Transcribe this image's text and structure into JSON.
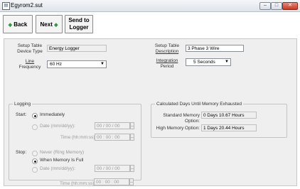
{
  "window": {
    "title": "Egyrom2.sut"
  },
  "toolbar": {
    "back_label": "Back",
    "next_label": "Next",
    "send_label_line1": "Send to",
    "send_label_line2": "Logger"
  },
  "setup": {
    "device_type_label_1": "Setup Table",
    "device_type_label_2": "Device Type",
    "device_type_value": "Energy Logger",
    "line_freq_label_1": "Line",
    "line_freq_label_2": "Frequency",
    "line_freq_value": "60 Hz",
    "description_label_1": "Setup Table",
    "description_label_2": "Description",
    "description_value": "3 Phase 3 Wire",
    "integration_label_1": "Integration",
    "integration_label_2": "Period",
    "integration_value": "5 Seconds"
  },
  "logging": {
    "group_title": "Logging",
    "start_label": "Start:",
    "start_immediately": "Immediately",
    "start_date_label": "Date (mm/dd/yy):",
    "start_date_value": "00 / 00 / 00",
    "start_time_label": "Time (hh:mm:ss):",
    "start_time_value": "00 : 00 : 00",
    "stop_label": "Stop:",
    "stop_never": "Never (Ring Memory)",
    "stop_full": "When Memory Is Full",
    "stop_date_label": "Date (mm/dd/yy):",
    "stop_date_value": "00 / 00 / 00",
    "stop_time_label": "Time (hh:mm:ss):",
    "stop_time_value": "00 : 00 : 00"
  },
  "memory": {
    "group_title": "Calculated Days Until Memory Exhausted",
    "standard_label": "Standard Memory Option:",
    "standard_value": "0 Days 10.67 Hours",
    "high_label": "High Memory Option:",
    "high_value": "1 Days 20.44 Hours"
  },
  "icons": {
    "back": "left-arrow-icon",
    "next": "right-arrow-icon",
    "dropdown": "chevron-down-icon"
  }
}
